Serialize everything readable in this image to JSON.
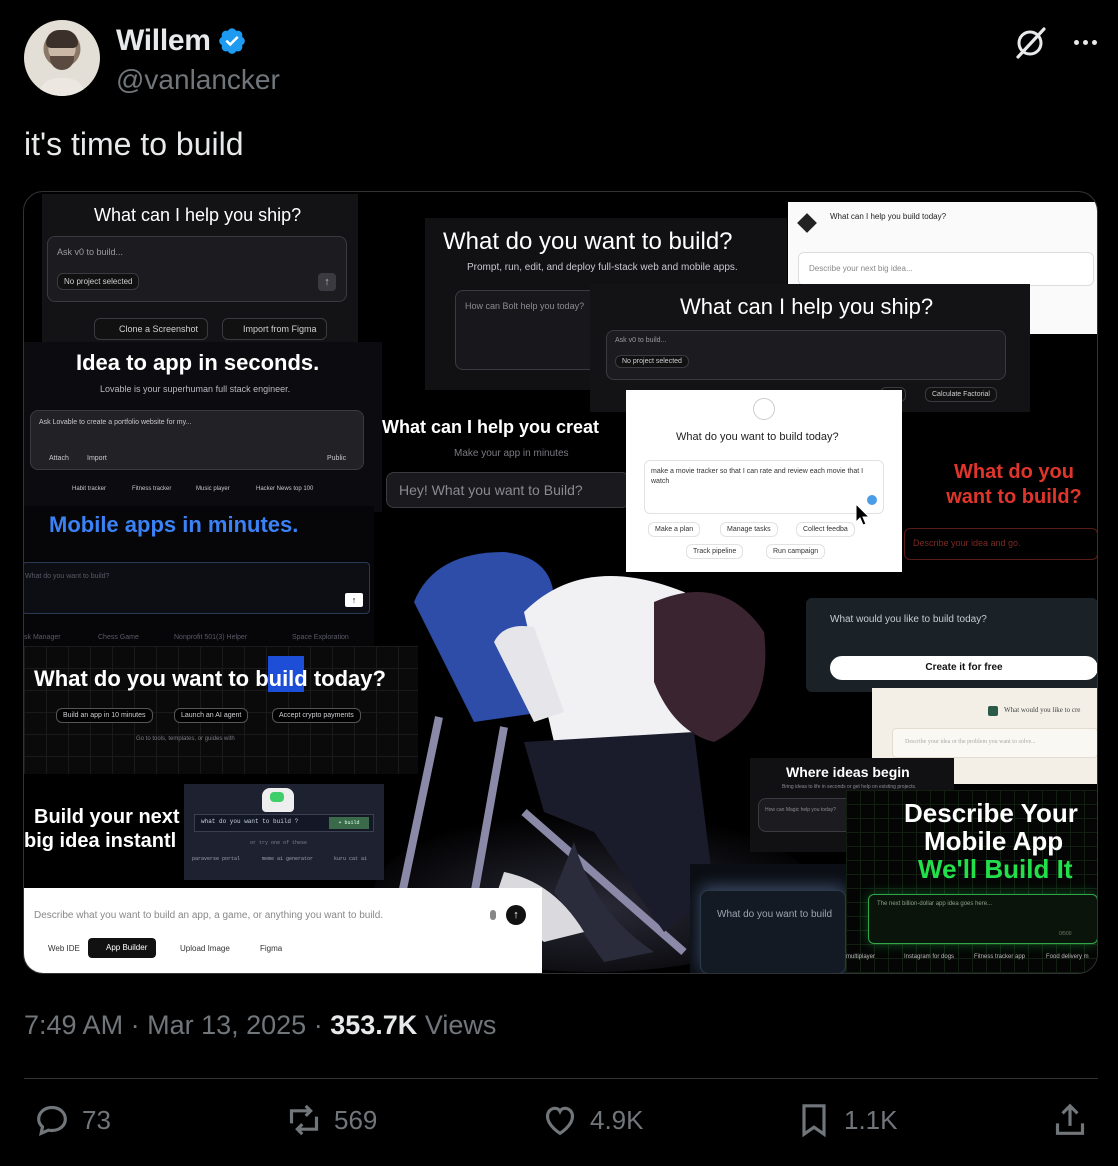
{
  "author": {
    "display_name": "Willem",
    "handle": "@vanlancker",
    "verified_color": "#1d9bf0"
  },
  "tweet": {
    "text": "it's time to build",
    "time": "7:49 AM",
    "separator": "·",
    "date": "Mar 13, 2025",
    "views_count": "353.7K",
    "views_label": "Views"
  },
  "actions": {
    "replies": "73",
    "reposts": "569",
    "likes": "4.9K",
    "bookmarks": "1.1K"
  },
  "icons": [
    "grok-icon",
    "more-icon",
    "reply-icon",
    "repost-icon",
    "like-icon",
    "bookmark-icon",
    "share-icon",
    "verified-icon"
  ],
  "collage": {
    "v0_a": {
      "title": "What can I help you ship?",
      "input": "Ask v0 to build...",
      "project": "No project selected",
      "btn1": "Clone a Screenshot",
      "btn2": "Import from Figma"
    },
    "bolt": {
      "title": "What do you want to build?",
      "sub": "Prompt, run, edit, and deploy full-stack web and mobile apps.",
      "input": "How can Bolt help you today?"
    },
    "notion": {
      "title": "What can I help you build today?",
      "input": "Describe your next big idea..."
    },
    "v0_b": {
      "title": "What can I help you ship?",
      "input": "Ask v0 to build...",
      "project": "No project selected",
      "btn1": "orm",
      "btn2": "Calculate Factorial"
    },
    "lovable": {
      "title": "Idea to app in seconds.",
      "sub": "Lovable is your superhuman full stack engineer.",
      "input": "Ask Lovable to create a portfolio website for my...",
      "attach": "Attach",
      "import": "Import",
      "public": "Public",
      "chips": [
        "Habit tracker",
        "Fitness tracker",
        "Music player",
        "Hacker News top 100"
      ]
    },
    "create": {
      "title": "What can I help you creat",
      "sub": "Make your app in minutes",
      "input": "Hey! What you want to Build?"
    },
    "center": {
      "title": "What do you want to build today?",
      "input": "make a movie tracker so that I can rate and review each movie that I watch",
      "chips": [
        "Make a plan",
        "Manage tasks",
        "Collect feedba",
        "Track pipeline",
        "Run campaign"
      ]
    },
    "red": {
      "title": "What do you want to build?",
      "input": "Describe your idea and go."
    },
    "mobile": {
      "title": "Mobile apps in minutes.",
      "input": "What do you want to build?",
      "chips": [
        "sk Manager",
        "Chess Game",
        "Nonprofit 501(3) Helper",
        "Space Exploration"
      ]
    },
    "build_today": {
      "title": "What do you want to build today?",
      "chips": [
        "Build an app in 10 minutes",
        "Launch an AI agent",
        "Accept crypto payments"
      ],
      "sub": "Go to tools, templates, or guides with"
    },
    "create_free": {
      "title": "What would you like to build today?",
      "button": "Create it for free"
    },
    "cream": {
      "title": "What would you like to cre",
      "input": "Describe your idea or the problem you want to solve..."
    },
    "ideas": {
      "title": "Where ideas begin",
      "sub": "Bring ideas to life in seconds or get help on existing projects.",
      "input": "How can Magic help you today?"
    },
    "build_next": {
      "line1": "Build your next",
      "line2": "big idea instantl"
    },
    "terminal": {
      "input": "what do you want to build ?",
      "button": "+ build",
      "sub": "or try one of these",
      "chips": [
        "paraverse portal",
        "meme ai generator",
        "kuru cat ai"
      ]
    },
    "app_builder": {
      "input": "Describe what you want to build an app, a game, or anything you want to build.",
      "tabs": [
        "Web IDE",
        "App Builder",
        "Upload Image",
        "Figma"
      ]
    },
    "glow": {
      "input": "What do you want to build"
    },
    "describe": {
      "line1": "Describe Your",
      "line2": "Mobile App",
      "line3": "We'll Build It",
      "input": "The next billion-dollar app idea goes here...",
      "counter": "0/500",
      "chips": [
        "multiplayer",
        "Instagram for dogs",
        "Fitness tracker app",
        "Food delivery m"
      ]
    }
  }
}
